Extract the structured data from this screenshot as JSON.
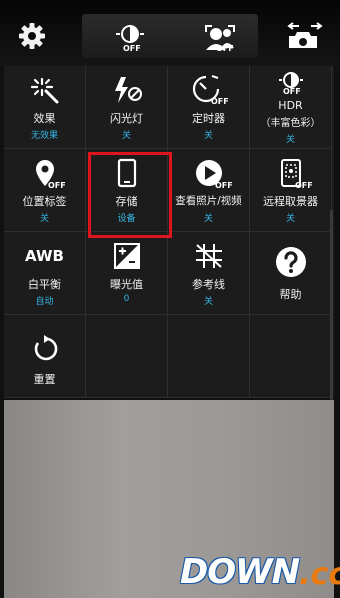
{
  "topbar": {
    "hdr_state": "OFF",
    "face_state": "OFF"
  },
  "grid": {
    "row1": [
      {
        "label": "效果",
        "value": "无效果"
      },
      {
        "label": "闪光灯",
        "value": "关"
      },
      {
        "label": "定时器",
        "value": "关",
        "badge": "OFF"
      },
      {
        "label": "HDR",
        "sub": "（丰富色彩）",
        "value": "关",
        "badge": "OFF"
      }
    ],
    "row2": [
      {
        "label": "位置标签",
        "value": "关",
        "badge": "OFF"
      },
      {
        "label": "存储",
        "value": "设备"
      },
      {
        "label": "查看照片/视频",
        "value": "关",
        "badge": "OFF"
      },
      {
        "label": "远程取景器",
        "value": "关",
        "badge": "OFF"
      }
    ],
    "row3": [
      {
        "label": "白平衡",
        "value": "自动",
        "icon_text": "AWB"
      },
      {
        "label": "曝光值",
        "value": "0"
      },
      {
        "label": "参考线",
        "value": "关"
      },
      {
        "label": "帮助"
      }
    ],
    "row4": [
      {
        "label": "重置"
      }
    ]
  },
  "watermark": {
    "part1": "DOWN",
    "part2": ".cc"
  }
}
